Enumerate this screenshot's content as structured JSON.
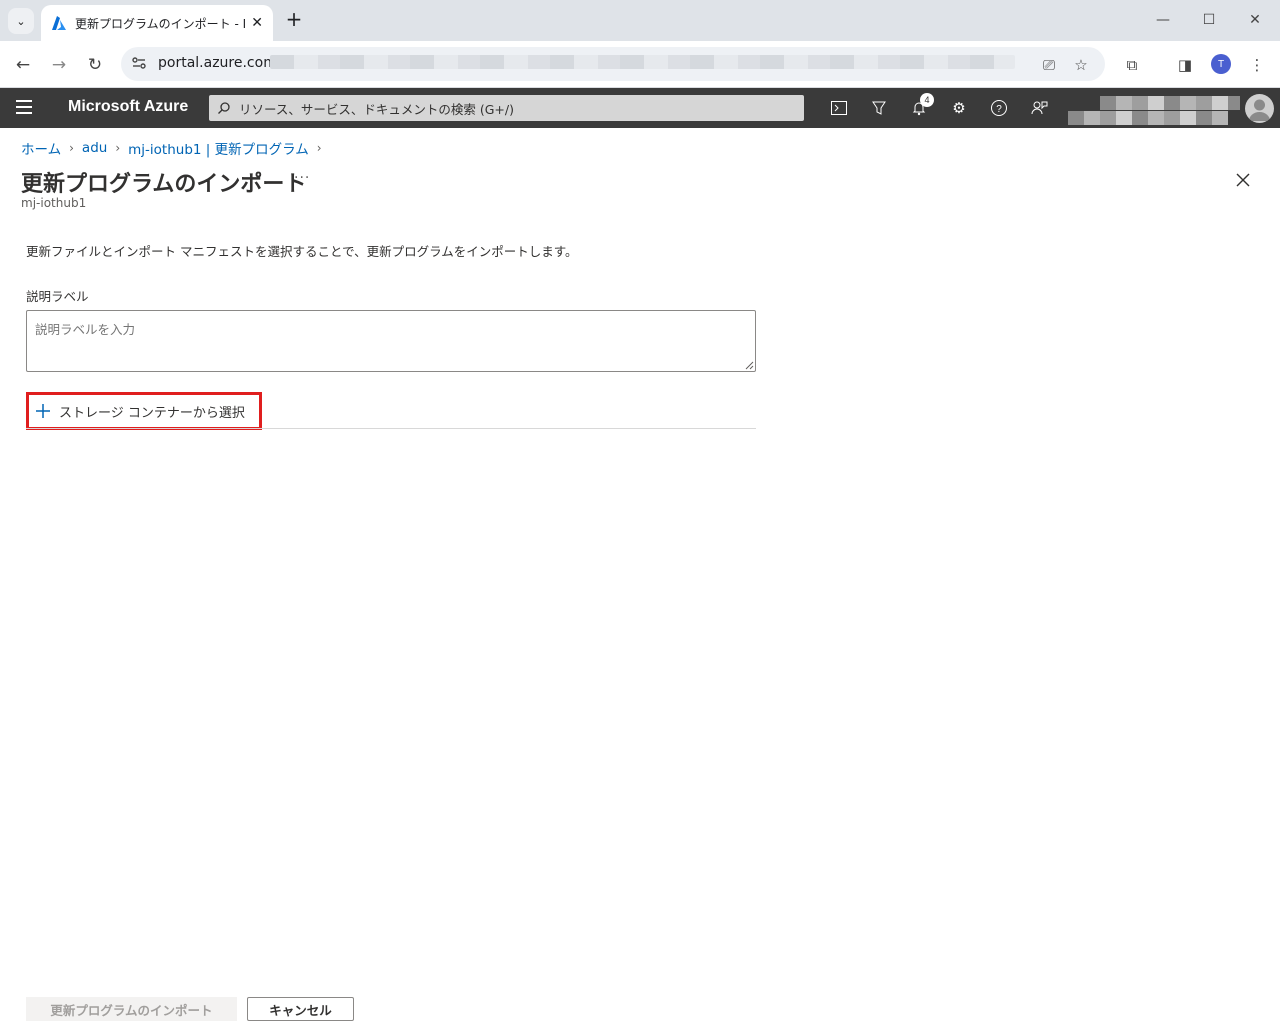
{
  "browser": {
    "tab_title": "更新プログラムのインポート - Microsoft Azure",
    "url_visible": "portal.azure.com/",
    "profile_initial": "T"
  },
  "azure": {
    "brand": "Microsoft Azure",
    "search_placeholder": "リソース、サービス、ドキュメントの検索 (G+/)",
    "notification_count": "4"
  },
  "breadcrumb": {
    "items": [
      "ホーム",
      "adu",
      "mj-iothub1 | 更新プログラム"
    ]
  },
  "page": {
    "title": "更新プログラムのインポート",
    "more": "···",
    "subtitle": "mj-iothub1",
    "description": "更新ファイルとインポート マニフェストを選択することで、更新プログラムをインポートします。",
    "field_label": "説明ラベル",
    "field_placeholder": "説明ラベルを入力",
    "select_label": "ストレージ コンテナーから選択"
  },
  "footer": {
    "import_label": "更新プログラムのインポート",
    "cancel_label": "キャンセル"
  },
  "colors": {
    "azure_bar": "#3a3a3a",
    "link": "#0064b4",
    "highlight": "#e01e1e"
  }
}
